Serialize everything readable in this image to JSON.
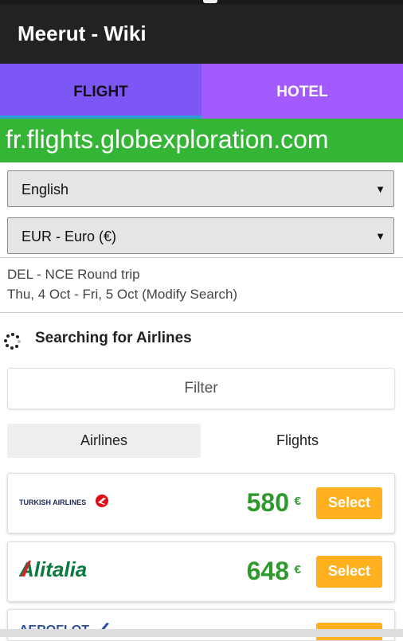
{
  "app": {
    "title": "Meerut - Wiki"
  },
  "tabs": [
    {
      "label": "FLIGHT"
    },
    {
      "label": "HOTEL"
    }
  ],
  "domain": "fr.flights.globexploration.com",
  "language_select": {
    "value": "English"
  },
  "currency_select": {
    "value": "EUR - Euro (€)"
  },
  "trip": {
    "route": "DEL - NCE Round trip",
    "dates": "Thu, 4 Oct - Fri, 5 Oct (Modify Search)"
  },
  "status": {
    "searching_label": "Searching for Airlines"
  },
  "filter": {
    "label": "Filter"
  },
  "segments": [
    {
      "label": "Airlines"
    },
    {
      "label": "Flights"
    }
  ],
  "results": [
    {
      "airline_logo": "TURKISH AIRLINES",
      "price": "580",
      "currency": "€",
      "button": "Select"
    },
    {
      "airline_logo": "Alitalia",
      "price": "648",
      "currency": "€",
      "button": "Select"
    },
    {
      "airline_logo": "AEROFLOT",
      "price": "",
      "currency": "",
      "button": ""
    }
  ],
  "colors": {
    "appbar": "#222222",
    "tab_bar": "#a35bff",
    "tab_active": "#7c57f5",
    "domain_bar": "#35b536",
    "price": "#2e9a2e",
    "select_button": "#ffb01f",
    "turkish_red": "#e30a17",
    "alitalia_green": "#0b7a3e"
  }
}
